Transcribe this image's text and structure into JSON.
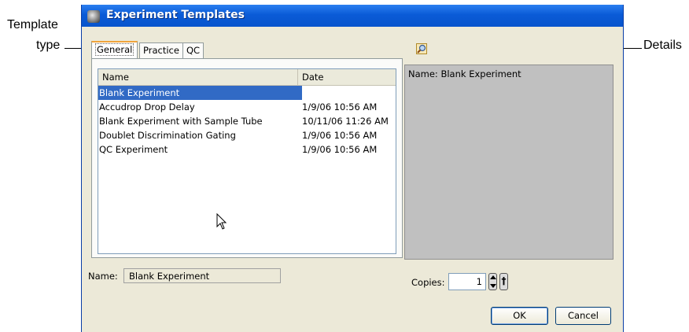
{
  "callouts": {
    "template_type_line1": "Template",
    "template_type_line2": "type",
    "details": "Details"
  },
  "window": {
    "title": "Experiment Templates"
  },
  "tabs": [
    {
      "label": "General",
      "active": true
    },
    {
      "label": "Practice",
      "active": false
    },
    {
      "label": "QC",
      "active": false
    }
  ],
  "table": {
    "columns": [
      "Name",
      "Date"
    ],
    "rows": [
      {
        "name": "Blank Experiment",
        "date": "",
        "selected": true
      },
      {
        "name": "Accudrop Drop Delay",
        "date": "1/9/06 10:56 AM"
      },
      {
        "name": "Blank Experiment with Sample Tube",
        "date": "10/11/06 11:26 AM"
      },
      {
        "name": "Doublet Discrimination Gating",
        "date": "1/9/06 10:56 AM"
      },
      {
        "name": "QC Experiment",
        "date": "1/9/06 10:56 AM"
      }
    ]
  },
  "name_field": {
    "label": "Name:",
    "value": "Blank Experiment"
  },
  "details": {
    "text": "Name: Blank Experiment",
    "icon": "magnifier-icon"
  },
  "copies": {
    "label": "Copies:",
    "value": "1"
  },
  "buttons": {
    "ok": "OK",
    "cancel": "Cancel"
  },
  "colors": {
    "titlebar": "#0a5bd7",
    "selection": "#316ac5",
    "window_bg": "#ece9d8",
    "details_bg": "#c0c0c0"
  }
}
